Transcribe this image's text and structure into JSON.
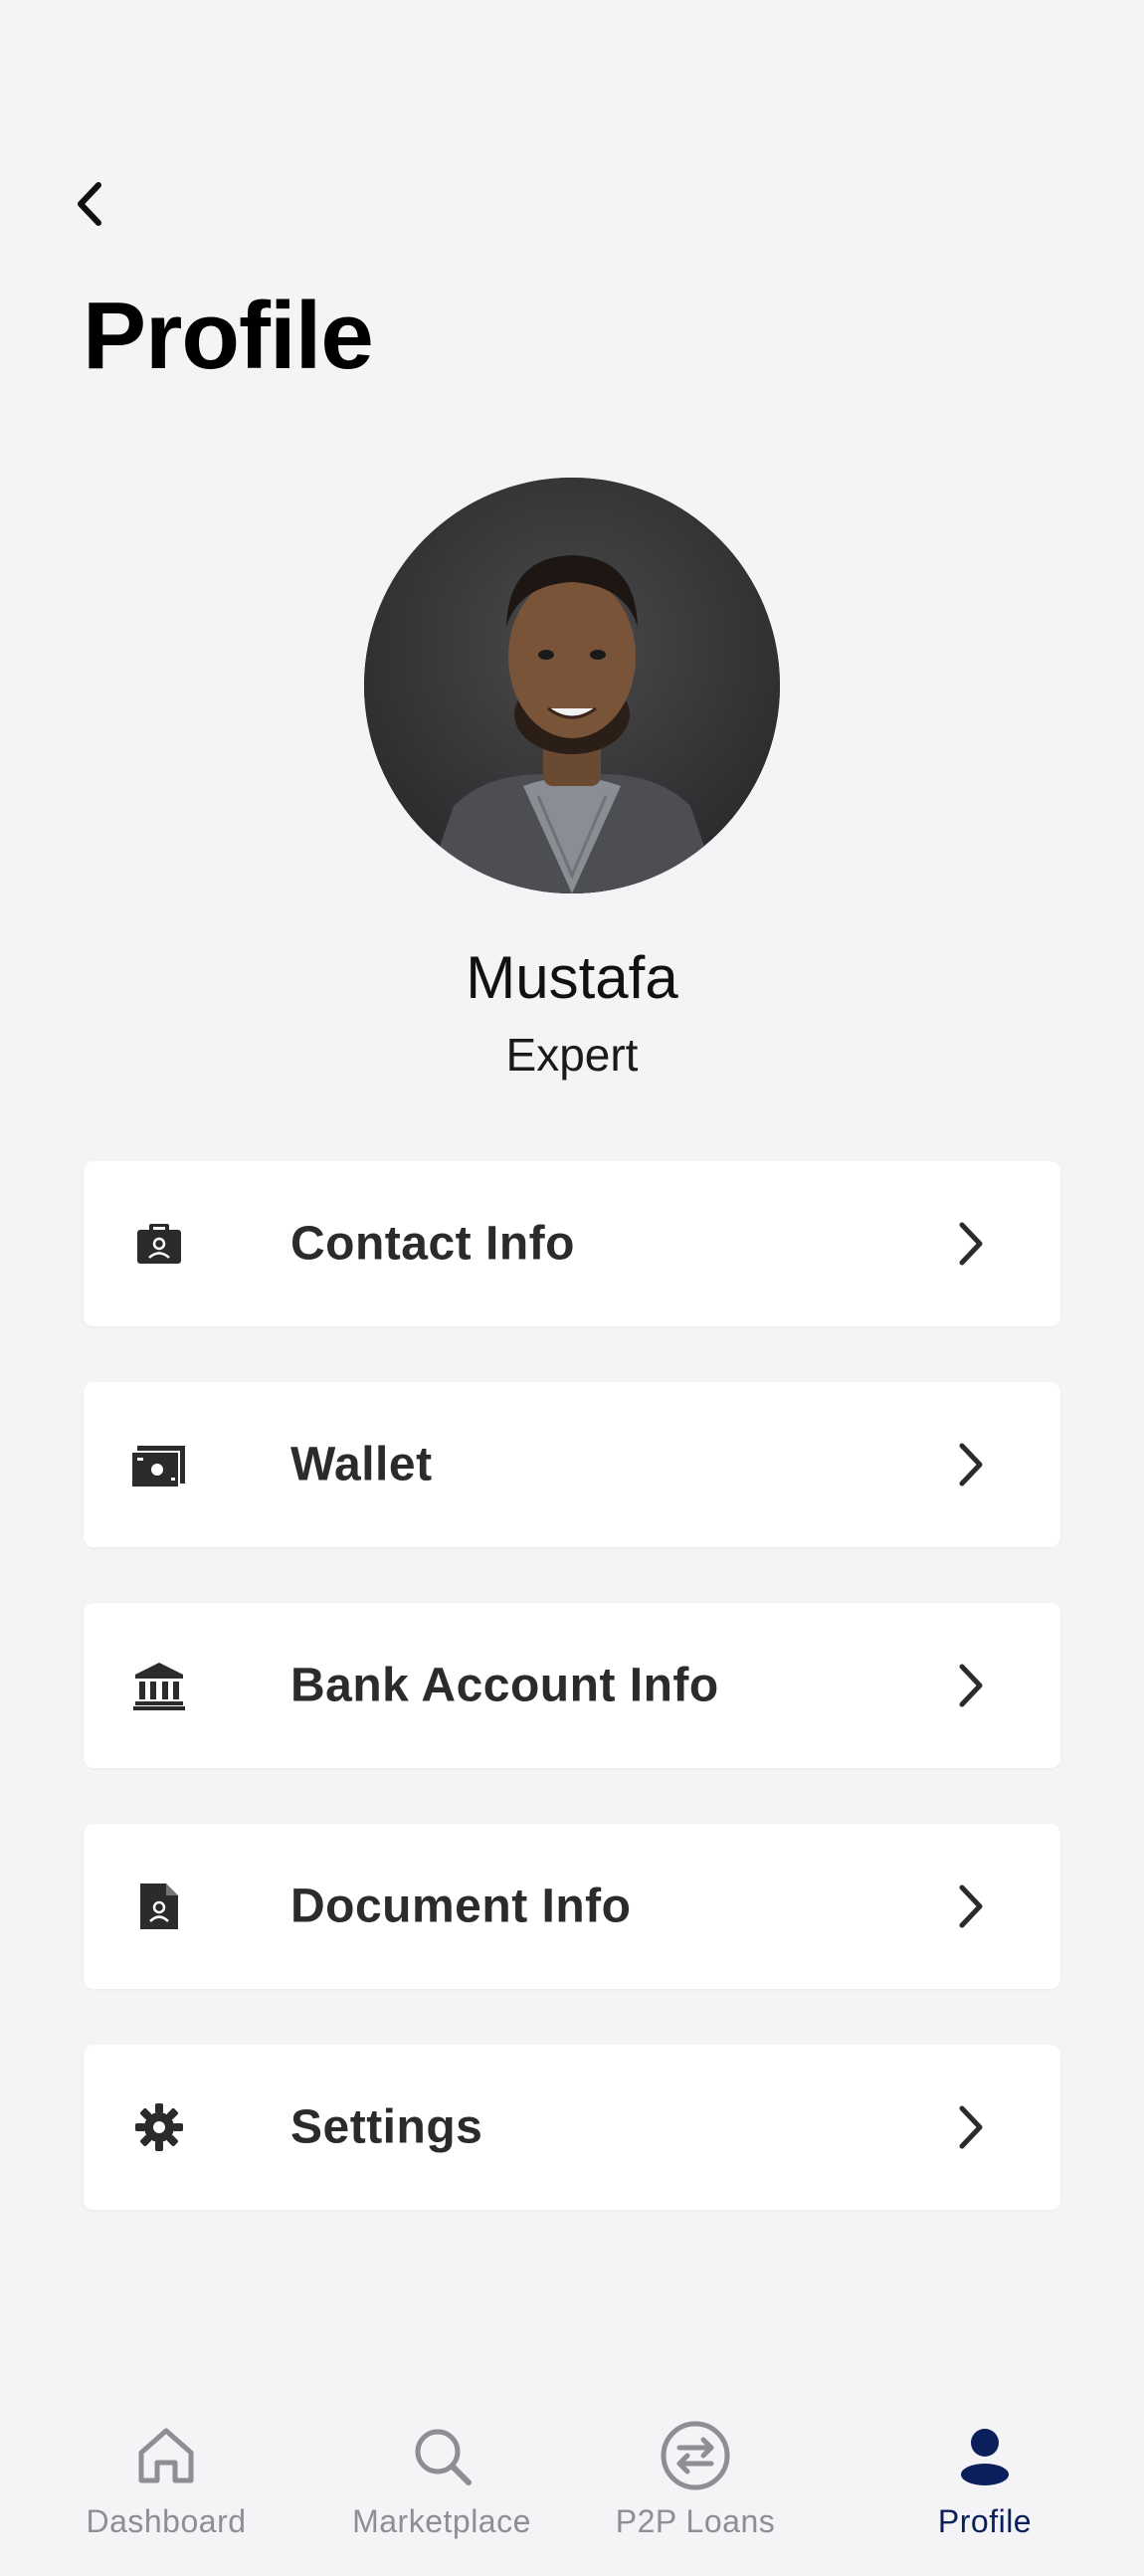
{
  "header": {
    "title": "Profile"
  },
  "profile": {
    "name": "Mustafa",
    "role": "Expert"
  },
  "menu": {
    "items": [
      {
        "label": "Contact Info",
        "icon": "contact-card-icon"
      },
      {
        "label": "Wallet",
        "icon": "wallet-icon"
      },
      {
        "label": "Bank Account Info",
        "icon": "bank-icon"
      },
      {
        "label": "Document Info",
        "icon": "document-person-icon"
      },
      {
        "label": "Settings",
        "icon": "gear-icon"
      }
    ]
  },
  "bottom_nav": {
    "items": [
      {
        "label": "Dashboard",
        "icon": "home-icon",
        "active": false
      },
      {
        "label": "Marketplace",
        "icon": "search-icon",
        "active": false
      },
      {
        "label": "P2P Loans",
        "icon": "exchange-arrows-icon",
        "active": false
      },
      {
        "label": "Profile",
        "icon": "person-icon",
        "active": true
      }
    ]
  },
  "colors": {
    "background": "#f4f4f6",
    "card": "#ffffff",
    "active_nav": "#0b1f5c",
    "inactive_nav": "#8e8e93"
  }
}
